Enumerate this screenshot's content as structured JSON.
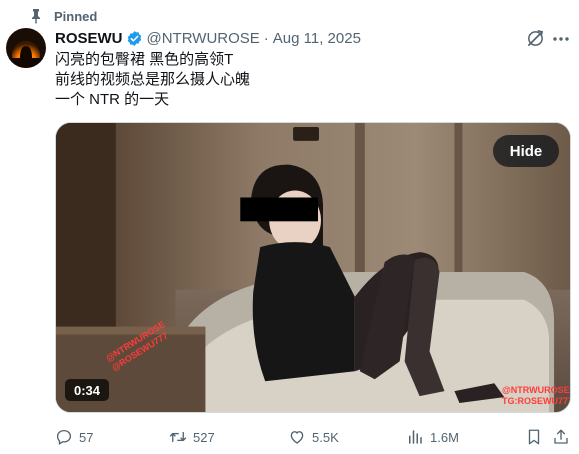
{
  "pinned": {
    "label": "Pinned"
  },
  "author": {
    "display_name": "ROSEWU",
    "handle": "@NTRWUROSE",
    "separator": "·",
    "date": "Aug 11, 2025"
  },
  "tweet": {
    "lines": [
      "闪亮的包臀裙 黑色的高领T",
      "前线的视频总是那么摄人心魄",
      "一个 NTR 的一天"
    ]
  },
  "media": {
    "hide_label": "Hide",
    "duration": "0:34",
    "watermark_left": [
      "@NTRWUROSE",
      "@ROSEWU777"
    ],
    "watermark_right": [
      "@NTRWUROSE",
      "TG:ROSEWU777"
    ]
  },
  "actions": {
    "replies": "57",
    "reposts": "527",
    "likes": "5.5K",
    "views": "1.6M"
  },
  "colors": {
    "text_primary": "#0f1419",
    "text_secondary": "#536471",
    "verified": "#1d9bf0"
  },
  "icons": [
    "pin-icon",
    "verified-icon",
    "grok-icon",
    "more-icon",
    "reply-icon",
    "repost-icon",
    "like-icon",
    "views-icon",
    "bookmark-icon",
    "share-icon"
  ]
}
